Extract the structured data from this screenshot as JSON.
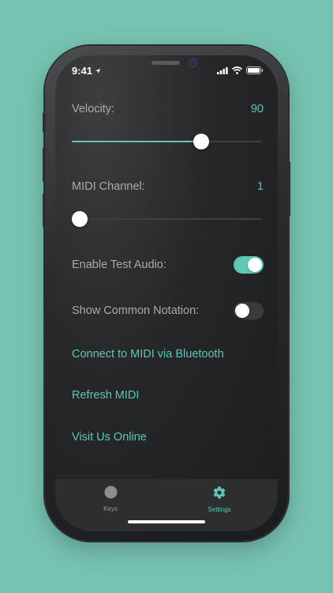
{
  "status": {
    "time": "9:41"
  },
  "settings": {
    "velocity": {
      "label": "Velocity:",
      "value": "90",
      "fraction": 0.7
    },
    "midi_channel": {
      "label": "MIDI Channel:",
      "value": "1",
      "fraction": 0.0
    },
    "test_audio": {
      "label": "Enable Test Audio:",
      "on": true
    },
    "notation": {
      "label": "Show Common Notation:",
      "on": false
    },
    "links": [
      "Connect to MIDI via Bluetooth",
      "Refresh MIDI",
      "Visit Us Online"
    ]
  },
  "tabs": [
    {
      "label": "Keys",
      "icon": "circle-icon",
      "active": false
    },
    {
      "label": "Settings",
      "icon": "gear-icon",
      "active": true
    }
  ],
  "colors": {
    "accent": "#5ec7b5",
    "background": "#77c3b2"
  }
}
